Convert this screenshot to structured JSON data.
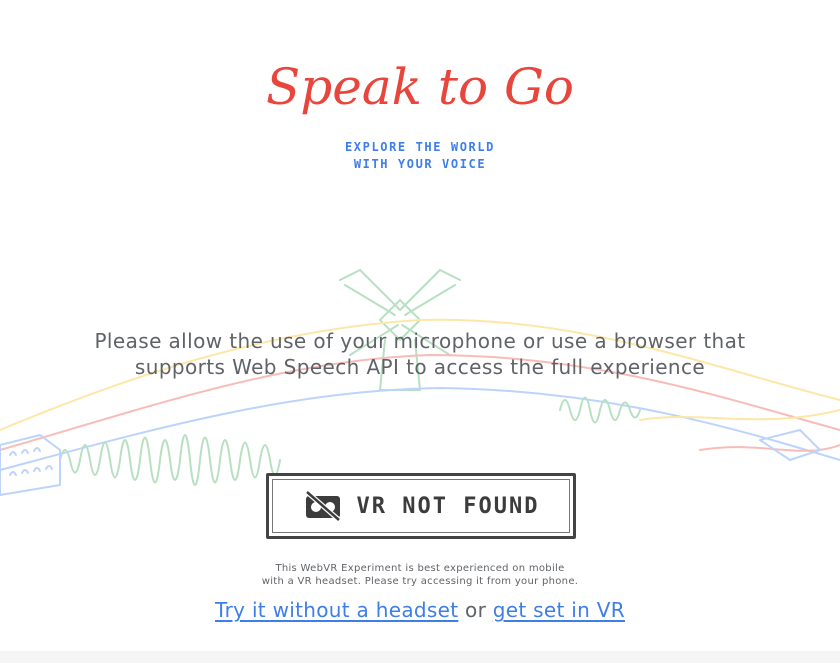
{
  "logo": {
    "text": "Speak to Go",
    "color": "#e8453c"
  },
  "tagline": {
    "line1": "EXPLORE THE WORLD",
    "line2": "WITH YOUR VOICE",
    "color": "#3d7ee8"
  },
  "message": {
    "line1": "Please allow the use of your microphone or use a browser that",
    "line2": "supports Web Speech API to access the full experience"
  },
  "vr_button": {
    "icon": "vr-headset-crossed-icon",
    "label": "VR NOT FOUND"
  },
  "note": {
    "line1": "This WebVR Experiment is best experienced on mobile",
    "line2": "with a VR headset. Please try accessing it from your phone."
  },
  "links": {
    "try_without": "Try it without a headset",
    "separator": "or",
    "get_set": "get set in VR",
    "color": "#3d7ee8"
  }
}
